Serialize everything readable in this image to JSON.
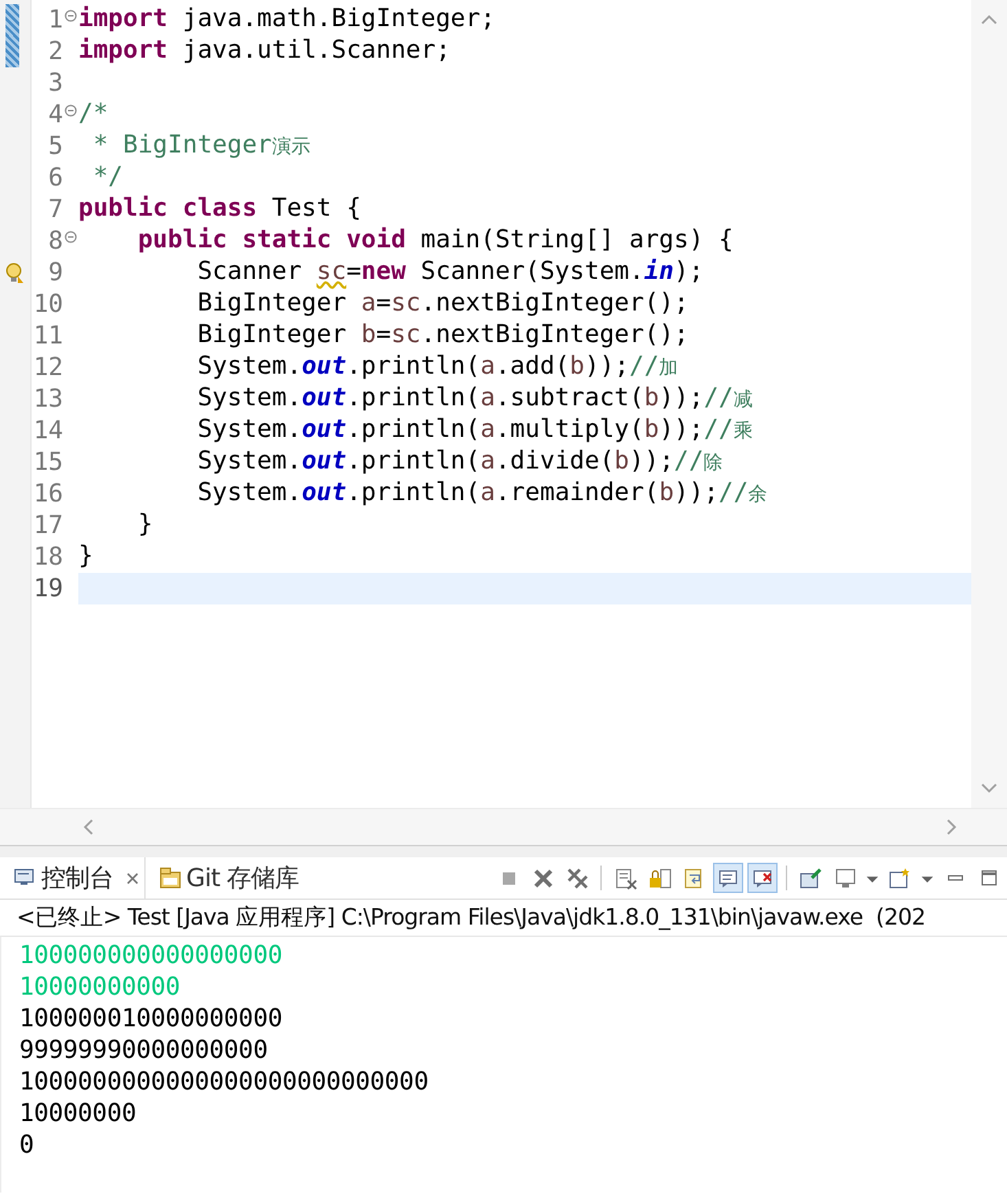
{
  "editor": {
    "lines": [
      {
        "number": "1",
        "fold": true,
        "changed": true,
        "warning": false,
        "current": false,
        "tokens": [
          {
            "text": "import",
            "kind": "keyword"
          },
          {
            "text": " java.math.BigInteger;",
            "kind": "plain"
          }
        ]
      },
      {
        "number": "2",
        "fold": false,
        "changed": true,
        "warning": false,
        "current": false,
        "tokens": [
          {
            "text": "import",
            "kind": "keyword"
          },
          {
            "text": " java.util.Scanner;",
            "kind": "plain"
          }
        ]
      },
      {
        "number": "3",
        "fold": false,
        "changed": false,
        "warning": false,
        "current": false
      },
      {
        "number": "4",
        "fold": true,
        "changed": false,
        "warning": false,
        "current": false,
        "tokens": [
          {
            "text": "/*",
            "kind": "comment"
          }
        ]
      },
      {
        "number": "5",
        "fold": false,
        "changed": false,
        "warning": false,
        "current": false,
        "tokens": [
          {
            "text": " * BigInteger",
            "kind": "comment"
          },
          {
            "text": "演示",
            "kind": "cjk"
          }
        ]
      },
      {
        "number": "6",
        "fold": false,
        "changed": false,
        "warning": false,
        "current": false,
        "tokens": [
          {
            "text": " */",
            "kind": "comment"
          }
        ]
      },
      {
        "number": "7",
        "fold": false,
        "changed": false,
        "warning": false,
        "current": false,
        "tokens": [
          {
            "text": "public class",
            "kind": "keyword"
          },
          {
            "text": " Test {",
            "kind": "plain"
          }
        ]
      },
      {
        "number": "8",
        "fold": true,
        "changed": false,
        "warning": false,
        "current": false,
        "tokens": [
          {
            "text": "    public static void",
            "kind": "keyword"
          },
          {
            "text": " main(String[] args) {",
            "kind": "plain"
          }
        ]
      },
      {
        "number": "9",
        "fold": false,
        "changed": false,
        "warning": true,
        "current": false,
        "tokens": [
          {
            "text": "        Scanner ",
            "kind": "plain"
          },
          {
            "text": "sc",
            "kind": "unused"
          },
          {
            "text": "=",
            "kind": "plain"
          },
          {
            "text": "new",
            "kind": "keyword"
          },
          {
            "text": " Scanner(System.",
            "kind": "plain"
          },
          {
            "text": "in",
            "kind": "field"
          },
          {
            "text": ");",
            "kind": "plain"
          }
        ]
      },
      {
        "number": "10",
        "fold": false,
        "changed": false,
        "warning": false,
        "current": false,
        "tokens": [
          {
            "text": "        BigInteger ",
            "kind": "plain"
          },
          {
            "text": "a",
            "kind": "local"
          },
          {
            "text": "=",
            "kind": "plain"
          },
          {
            "text": "sc",
            "kind": "local"
          },
          {
            "text": ".nextBigInteger();",
            "kind": "plain"
          }
        ]
      },
      {
        "number": "11",
        "fold": false,
        "changed": false,
        "warning": false,
        "current": false,
        "tokens": [
          {
            "text": "        BigInteger ",
            "kind": "plain"
          },
          {
            "text": "b",
            "kind": "local"
          },
          {
            "text": "=",
            "kind": "plain"
          },
          {
            "text": "sc",
            "kind": "local"
          },
          {
            "text": ".nextBigInteger();",
            "kind": "plain"
          }
        ]
      },
      {
        "number": "12",
        "fold": false,
        "changed": false,
        "warning": false,
        "current": false,
        "tokens": [
          {
            "text": "        System.",
            "kind": "plain"
          },
          {
            "text": "out",
            "kind": "field"
          },
          {
            "text": ".println(",
            "kind": "plain"
          },
          {
            "text": "a",
            "kind": "local"
          },
          {
            "text": ".add(",
            "kind": "plain"
          },
          {
            "text": "b",
            "kind": "local"
          },
          {
            "text": "));",
            "kind": "plain"
          },
          {
            "text": "//",
            "kind": "linecomment"
          },
          {
            "text": "加",
            "kind": "cjk"
          }
        ]
      },
      {
        "number": "13",
        "fold": false,
        "changed": false,
        "warning": false,
        "current": false,
        "tokens": [
          {
            "text": "        System.",
            "kind": "plain"
          },
          {
            "text": "out",
            "kind": "field"
          },
          {
            "text": ".println(",
            "kind": "plain"
          },
          {
            "text": "a",
            "kind": "local"
          },
          {
            "text": ".subtract(",
            "kind": "plain"
          },
          {
            "text": "b",
            "kind": "local"
          },
          {
            "text": "));",
            "kind": "plain"
          },
          {
            "text": "//",
            "kind": "linecomment"
          },
          {
            "text": "减",
            "kind": "cjk"
          }
        ]
      },
      {
        "number": "14",
        "fold": false,
        "changed": false,
        "warning": false,
        "current": false,
        "tokens": [
          {
            "text": "        System.",
            "kind": "plain"
          },
          {
            "text": "out",
            "kind": "field"
          },
          {
            "text": ".println(",
            "kind": "plain"
          },
          {
            "text": "a",
            "kind": "local"
          },
          {
            "text": ".multiply(",
            "kind": "plain"
          },
          {
            "text": "b",
            "kind": "local"
          },
          {
            "text": "));",
            "kind": "plain"
          },
          {
            "text": "//",
            "kind": "linecomment"
          },
          {
            "text": "乘",
            "kind": "cjk"
          }
        ]
      },
      {
        "number": "15",
        "fold": false,
        "changed": false,
        "warning": false,
        "current": false,
        "tokens": [
          {
            "text": "        System.",
            "kind": "plain"
          },
          {
            "text": "out",
            "kind": "field"
          },
          {
            "text": ".println(",
            "kind": "plain"
          },
          {
            "text": "a",
            "kind": "local"
          },
          {
            "text": ".divide(",
            "kind": "plain"
          },
          {
            "text": "b",
            "kind": "local"
          },
          {
            "text": "));",
            "kind": "plain"
          },
          {
            "text": "//",
            "kind": "linecomment"
          },
          {
            "text": "除",
            "kind": "cjk"
          }
        ]
      },
      {
        "number": "16",
        "fold": false,
        "changed": false,
        "warning": false,
        "current": false,
        "tokens": [
          {
            "text": "        System.",
            "kind": "plain"
          },
          {
            "text": "out",
            "kind": "field"
          },
          {
            "text": ".println(",
            "kind": "plain"
          },
          {
            "text": "a",
            "kind": "local"
          },
          {
            "text": ".remainder(",
            "kind": "plain"
          },
          {
            "text": "b",
            "kind": "local"
          },
          {
            "text": "));",
            "kind": "plain"
          },
          {
            "text": "//",
            "kind": "linecomment"
          },
          {
            "text": "余",
            "kind": "cjk"
          }
        ]
      },
      {
        "number": "17",
        "fold": false,
        "changed": false,
        "warning": false,
        "current": false,
        "tokens": [
          {
            "text": "    }",
            "kind": "plain"
          }
        ]
      },
      {
        "number": "18",
        "fold": false,
        "changed": false,
        "warning": false,
        "current": false,
        "tokens": [
          {
            "text": "}",
            "kind": "plain"
          }
        ]
      },
      {
        "number": "19",
        "fold": false,
        "changed": false,
        "warning": false,
        "current": true
      }
    ]
  },
  "console": {
    "tabs": [
      {
        "label": "控制台",
        "kind": "console",
        "selected": true,
        "closable": true
      },
      {
        "label": "Git 存储库",
        "kind": "git",
        "selected": false,
        "closable": false
      }
    ],
    "toolbar_groups": [
      [
        {
          "kind": "stop",
          "selected": false
        },
        {
          "kind": "remove",
          "selected": false
        },
        {
          "kind": "remove-all",
          "selected": false
        }
      ],
      [
        {
          "kind": "clear",
          "selected": false
        },
        {
          "kind": "lock",
          "selected": false
        },
        {
          "kind": "wrap",
          "selected": false
        },
        {
          "kind": "show-out",
          "selected": true
        },
        {
          "kind": "show-err",
          "selected": true
        }
      ],
      [
        {
          "kind": "pin",
          "selected": false
        },
        {
          "kind": "display",
          "selected": false
        },
        {
          "kind": "dropdown",
          "selected": false
        },
        {
          "kind": "new",
          "selected": false
        },
        {
          "kind": "dropdown",
          "selected": false
        },
        {
          "kind": "minimize",
          "selected": false
        },
        {
          "kind": "maximize",
          "selected": false
        }
      ]
    ],
    "header": "<已终止> Test [Java 应用程序] C:\\Program Files\\Java\\jdk1.8.0_131\\bin\\javaw.exe  (202",
    "output": [
      {
        "text": "100000000000000000",
        "kind": "input"
      },
      {
        "text": "10000000000",
        "kind": "input"
      },
      {
        "text": "100000010000000000",
        "kind": "output"
      },
      {
        "text": "99999990000000000",
        "kind": "output"
      },
      {
        "text": "1000000000000000000000000000",
        "kind": "output"
      },
      {
        "text": "10000000",
        "kind": "output"
      },
      {
        "text": "0",
        "kind": "output"
      }
    ]
  }
}
